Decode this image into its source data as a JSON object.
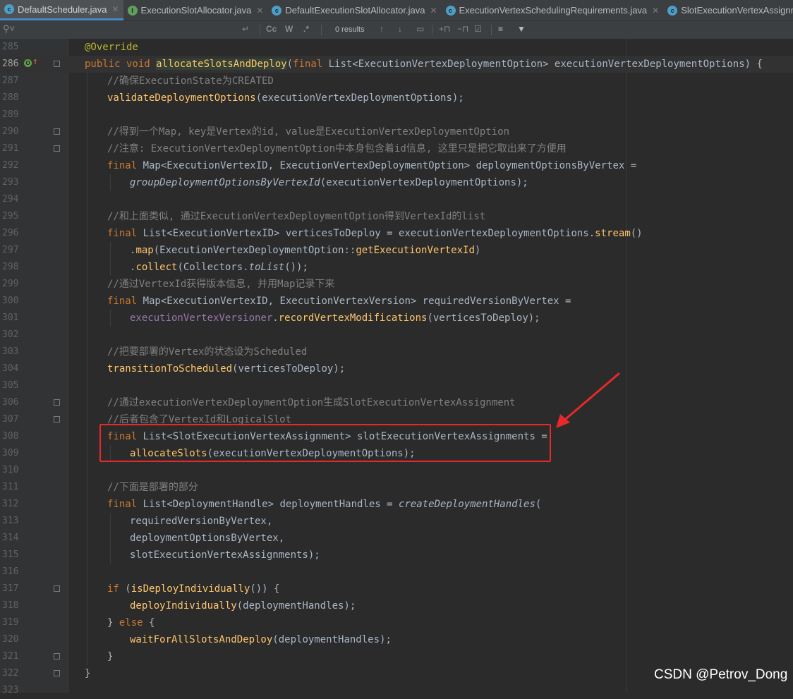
{
  "tabs": [
    {
      "label": "DefaultScheduler.java",
      "icon": "class-icon",
      "active": true
    },
    {
      "label": "ExecutionSlotAllocator.java",
      "icon": "interface-icon",
      "active": false
    },
    {
      "label": "DefaultExecutionSlotAllocator.java",
      "icon": "class-icon",
      "active": false
    },
    {
      "label": "ExecutionVertexSchedulingRequirements.java",
      "icon": "class-icon",
      "active": false
    },
    {
      "label": "SlotExecutionVertexAssignm",
      "icon": "class-icon",
      "active": false
    }
  ],
  "find": {
    "results": "0 results",
    "case": "Cc",
    "word": "W",
    "regex": ".*"
  },
  "lines": [
    {
      "n": "285",
      "t": "@Override"
    },
    {
      "n": "286",
      "t": "public void allocateSlotsAndDeploy(final List<ExecutionVertexDeploymentOption> executionVertexDeploymentOptions) {"
    },
    {
      "n": "287",
      "t": "//确保ExecutionState为CREATED"
    },
    {
      "n": "288",
      "t": "validateDeploymentOptions(executionVertexDeploymentOptions);"
    },
    {
      "n": "289",
      "t": ""
    },
    {
      "n": "290",
      "t": "//得到一个Map, key是Vertex的id, value是ExecutionVertexDeploymentOption"
    },
    {
      "n": "291",
      "t": "//注意: ExecutionVertexDeploymentOption中本身包含着id信息, 这里只是把它取出来了方便用"
    },
    {
      "n": "292",
      "t": "final Map<ExecutionVertexID, ExecutionVertexDeploymentOption> deploymentOptionsByVertex ="
    },
    {
      "n": "293",
      "t": "groupDeploymentOptionsByVertexId(executionVertexDeploymentOptions);"
    },
    {
      "n": "294",
      "t": ""
    },
    {
      "n": "295",
      "t": "//和上面类似, 通过ExecutionVertexDeploymentOption得到VertexId的list"
    },
    {
      "n": "296",
      "t": "final List<ExecutionVertexID> verticesToDeploy = executionVertexDeploymentOptions.stream()"
    },
    {
      "n": "297",
      "t": ".map(ExecutionVertexDeploymentOption::getExecutionVertexId)"
    },
    {
      "n": "298",
      "t": ".collect(Collectors.toList());"
    },
    {
      "n": "299",
      "t": "//通过VertexId获得版本信息, 并用Map记录下来"
    },
    {
      "n": "300",
      "t": "final Map<ExecutionVertexID, ExecutionVertexVersion> requiredVersionByVertex ="
    },
    {
      "n": "301",
      "t": "executionVertexVersioner.recordVertexModifications(verticesToDeploy);"
    },
    {
      "n": "302",
      "t": ""
    },
    {
      "n": "303",
      "t": "//把要部署的Vertex的状态设为Scheduled"
    },
    {
      "n": "304",
      "t": "transitionToScheduled(verticesToDeploy);"
    },
    {
      "n": "305",
      "t": ""
    },
    {
      "n": "306",
      "t": "//通过executionVertexDeploymentOption生成SlotExecutionVertexAssignment"
    },
    {
      "n": "307",
      "t": "//后者包含了VertexId和LogicalSlot"
    },
    {
      "n": "308",
      "t": "final List<SlotExecutionVertexAssignment> slotExecutionVertexAssignments ="
    },
    {
      "n": "309",
      "t": "allocateSlots(executionVertexDeploymentOptions);"
    },
    {
      "n": "310",
      "t": ""
    },
    {
      "n": "311",
      "t": "//下面是部署的部分"
    },
    {
      "n": "312",
      "t": "final List<DeploymentHandle> deploymentHandles = createDeploymentHandles("
    },
    {
      "n": "313",
      "t": "requiredVersionByVertex,"
    },
    {
      "n": "314",
      "t": "deploymentOptionsByVertex,"
    },
    {
      "n": "315",
      "t": "slotExecutionVertexAssignments);"
    },
    {
      "n": "316",
      "t": ""
    },
    {
      "n": "317",
      "t": "if (isDeployIndividually()) {"
    },
    {
      "n": "318",
      "t": "deployIndividually(deploymentHandles);"
    },
    {
      "n": "319",
      "t": "} else {"
    },
    {
      "n": "320",
      "t": "waitForAllSlotsAndDeploy(deploymentHandles);"
    },
    {
      "n": "321",
      "t": "}"
    },
    {
      "n": "322",
      "t": "}"
    },
    {
      "n": "323",
      "t": ""
    }
  ],
  "watermark": "CSDN @Petrov_Dong",
  "colors": {
    "keyword": "#cc7832",
    "method": "#ffc66d",
    "comment": "#808080",
    "annotation": "#bbb529",
    "highlight": "#e8282a"
  }
}
